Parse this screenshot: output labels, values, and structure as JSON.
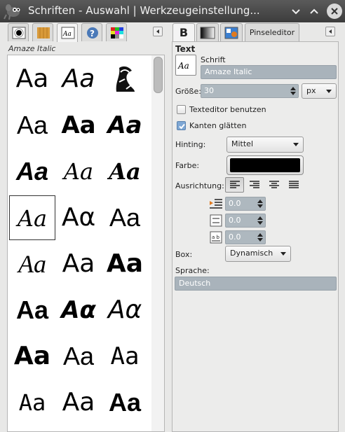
{
  "window": {
    "title": "Schriften - Auswahl | Werkzeugeinstellung...",
    "icons": [
      "gimp-logo-icon",
      "minimize-chevron-icon",
      "maximize-chevron-icon",
      "close-icon"
    ]
  },
  "left_dock": {
    "tabs": [
      {
        "name": "brushes-tab",
        "icon": "brush-icon",
        "active": false
      },
      {
        "name": "patterns-tab",
        "icon": "pattern-wood-icon",
        "active": false
      },
      {
        "name": "fonts-tab",
        "icon": "font-aa-icon",
        "active": true
      },
      {
        "name": "help-tab",
        "icon": "help-icon",
        "active": false
      },
      {
        "name": "palettes-tab",
        "icon": "palette-grid-icon",
        "active": false
      }
    ],
    "selected_font": "Amaze Italic",
    "font_previews": [
      "Aa",
      "Aa",
      "",
      "Aa",
      "Aa",
      "Aa",
      "Aa",
      "Aa",
      "Aa",
      "Aa",
      "Aα",
      "Aa",
      "Aa",
      "Aa",
      "Aa",
      "Aa",
      "Aα",
      "Aα",
      "Aa",
      "Aa",
      "Aa",
      "Aa",
      "Aa",
      "Aa"
    ]
  },
  "right_dock": {
    "tabs": [
      {
        "name": "text-tool-tab",
        "label": "B",
        "active": true
      },
      {
        "name": "gradient-tab",
        "label": "",
        "active": false
      },
      {
        "name": "image-tab",
        "label": "",
        "active": false
      },
      {
        "name": "brush-editor-tab",
        "label": "Pinseleditor",
        "active": false
      }
    ],
    "section_title": "Text",
    "font_label": "Schrift",
    "font_value": "Amaze Italic",
    "size_label": "Größe:",
    "size_value": "30",
    "size_unit": "px",
    "use_editor_label": "Texteditor benutzen",
    "use_editor_checked": false,
    "antialias_label": "Kanten glätten",
    "antialias_checked": true,
    "hinting_label": "Hinting:",
    "hinting_value": "Mittel",
    "color_label": "Farbe:",
    "color_value": "#000000",
    "justify_label": "Ausrichtung:",
    "indent_value": "0.0",
    "line_spacing_value": "0.0",
    "letter_spacing_value": "0.0",
    "box_label": "Box:",
    "box_value": "Dynamisch",
    "language_label": "Sprache:",
    "language_value": "Deutsch"
  }
}
